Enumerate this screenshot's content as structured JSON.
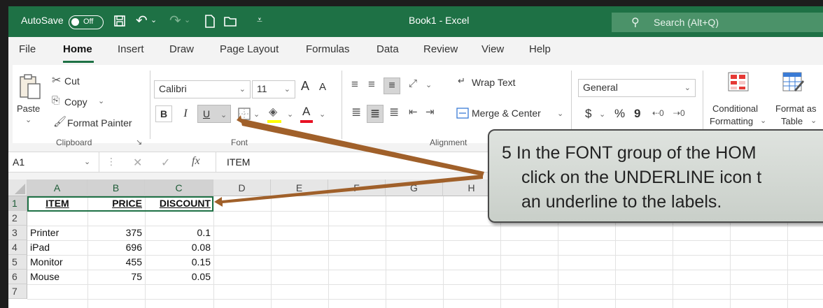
{
  "titlebar": {
    "autosave_label": "AutoSave",
    "autosave_state": "Off",
    "title": "Book1  -  Excel",
    "search_placeholder": "Search (Alt+Q)"
  },
  "tabs": [
    "File",
    "Home",
    "Insert",
    "Draw",
    "Page Layout",
    "Formulas",
    "Data",
    "Review",
    "View",
    "Help"
  ],
  "active_tab": "Home",
  "ribbon": {
    "clipboard": {
      "paste": "Paste",
      "cut": "Cut",
      "copy": "Copy",
      "format_painter": "Format Painter",
      "label": "Clipboard"
    },
    "font": {
      "font_name": "Calibri",
      "font_size": "11",
      "bold": "B",
      "italic": "I",
      "underline": "U",
      "font_color_letter": "A",
      "grow": "A",
      "shrink": "A",
      "label": "Font"
    },
    "alignment": {
      "wrap_text": "Wrap Text",
      "merge_center": "Merge & Center",
      "label": "Alignment"
    },
    "number": {
      "format": "General",
      "currency": "$",
      "percent": "%",
      "comma": "9"
    },
    "styles": {
      "conditional_1": "Conditional",
      "conditional_2": "Formatting",
      "table_1": "Format as",
      "table_2": "Table"
    }
  },
  "formula_bar": {
    "cell_ref": "A1",
    "fx": "fx",
    "content": "ITEM"
  },
  "grid": {
    "columns": [
      "A",
      "B",
      "C",
      "D",
      "E",
      "F",
      "G",
      "H"
    ],
    "rows": [
      "1",
      "2",
      "3",
      "4",
      "5",
      "6",
      "7"
    ],
    "headers": [
      "ITEM",
      "PRICE",
      "DISCOUNT"
    ],
    "data": [
      [
        "Printer",
        "375",
        "0.1"
      ],
      [
        "iPad",
        "696",
        "0.08"
      ],
      [
        "Monitor",
        "455",
        "0.15"
      ],
      [
        "Mouse",
        "75",
        "0.05"
      ]
    ]
  },
  "callout": {
    "line1": "5  In the FONT group of the HOM",
    "line2": "click on the UNDERLINE icon t",
    "line3": "an underline to the labels."
  },
  "colors": {
    "excel_green": "#1e7145",
    "arrow": "#a0602a"
  }
}
